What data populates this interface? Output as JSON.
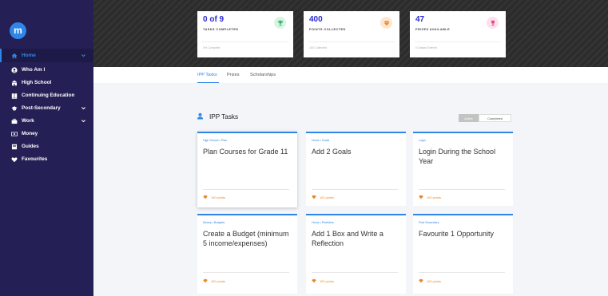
{
  "app": {
    "logo_letter": "m"
  },
  "sidebar": {
    "items": [
      {
        "label": "Home",
        "icon": "home-icon",
        "active": true,
        "chevron": true
      },
      {
        "label": "Who Am I",
        "icon": "person-circle-icon"
      },
      {
        "label": "High School",
        "icon": "school-icon"
      },
      {
        "label": "Continuing Education",
        "icon": "book-icon"
      },
      {
        "label": "Post-Secondary",
        "icon": "graduation-cap-icon",
        "chevron": true
      },
      {
        "label": "Work",
        "icon": "briefcase-icon",
        "chevron": true
      },
      {
        "label": "Money",
        "icon": "money-icon"
      },
      {
        "label": "Guides",
        "icon": "guide-book-icon"
      },
      {
        "label": "Favourites",
        "icon": "heart-icon"
      }
    ]
  },
  "stats": [
    {
      "value": "0 of 9",
      "label": "TASKS COMPLETED",
      "footer": "0% Complete",
      "icon": "trophy-icon",
      "icon_bg": "#d9f5e2",
      "icon_color": "#2bb673"
    },
    {
      "value": "400",
      "label": "POINTS COLLECTED",
      "footer": "100 Collected",
      "icon": "gem-icon",
      "icon_bg": "#fde6d2",
      "icon_color": "#f08a24"
    },
    {
      "value": "47",
      "label": "PRIZES AVAILABLE",
      "footer": "0 Draws Entered",
      "icon": "trophy-cup-icon",
      "icon_bg": "#fde0ec",
      "icon_color": "#e8488a"
    }
  ],
  "tabs": [
    "IPP Tasks",
    "Prizes",
    "Scholarships"
  ],
  "section": {
    "title": "IPP Tasks",
    "toggle": {
      "active": "Active",
      "inactive": "Completed"
    }
  },
  "tasks": [
    {
      "category": "High School • Plan",
      "title": "Plan Courses for Grade 11",
      "points": "100 points"
    },
    {
      "category": "Home • Goals",
      "title": "Add 2 Goals",
      "points": "100 points"
    },
    {
      "category": "Login",
      "title": "Login During the School Year",
      "points": "100 points"
    },
    {
      "category": "Money • Budgets",
      "title": "Create a Budget (minimum 5 income/expenses)",
      "points": "100 points"
    },
    {
      "category": "Home • Portfolios",
      "title": "Add 1 Box and Write a Reflection",
      "points": "100 points"
    },
    {
      "category": "Post Secondary",
      "title": "Favourite 1 Opportunity",
      "points": "100 points"
    }
  ],
  "colors": {
    "sidebar": "#241f55",
    "accent": "#2f86e8",
    "stat_value": "#2a2ad0",
    "points": "#e9882a"
  }
}
